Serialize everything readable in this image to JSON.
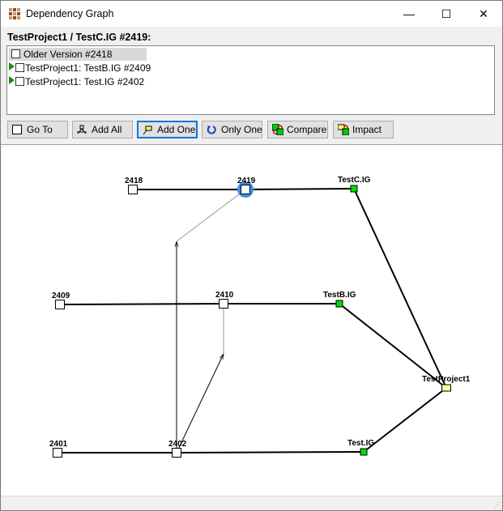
{
  "window": {
    "title": "Dependency Graph",
    "minimize": "—",
    "maximize": "☐",
    "close": "✕"
  },
  "header": "TestProject1 / TestC.IG #2419:",
  "list": [
    {
      "label": "Older Version #2418",
      "selected": true,
      "arrow": false
    },
    {
      "label": "TestProject1: TestB.IG #2409",
      "selected": false,
      "arrow": true
    },
    {
      "label": "TestProject1: Test.IG #2402",
      "selected": false,
      "arrow": true
    }
  ],
  "buttons": [
    {
      "label": "Go To",
      "icon": "checkbox-icon"
    },
    {
      "label": "Add All",
      "icon": "graph-node-icon"
    },
    {
      "label": "Add One",
      "icon": "add-node-icon",
      "active": true
    },
    {
      "label": "Only One",
      "icon": "refresh-icon"
    },
    {
      "label": "Compare",
      "icon": "compare-icon"
    },
    {
      "label": "Impact",
      "icon": "impact-icon"
    }
  ],
  "graph": {
    "selected": "2419",
    "colors": {
      "selection": "#3c8ee8",
      "component": "#00dd00",
      "project": "#ffff99"
    },
    "nodes": [
      {
        "id": "2418",
        "label": "2418",
        "kind": "version"
      },
      {
        "id": "2419",
        "label": "2419",
        "kind": "version"
      },
      {
        "id": "TestC",
        "label": "TestC.IG",
        "kind": "component"
      },
      {
        "id": "2409",
        "label": "2409",
        "kind": "version"
      },
      {
        "id": "2410",
        "label": "2410",
        "kind": "version"
      },
      {
        "id": "TestB",
        "label": "TestB.IG",
        "kind": "component"
      },
      {
        "id": "TP1",
        "label": "TestProject1",
        "kind": "project"
      },
      {
        "id": "2401",
        "label": "2401",
        "kind": "version"
      },
      {
        "id": "2402",
        "label": "2402",
        "kind": "version"
      },
      {
        "id": "TestIG",
        "label": "Test.IG",
        "kind": "component"
      }
    ]
  }
}
